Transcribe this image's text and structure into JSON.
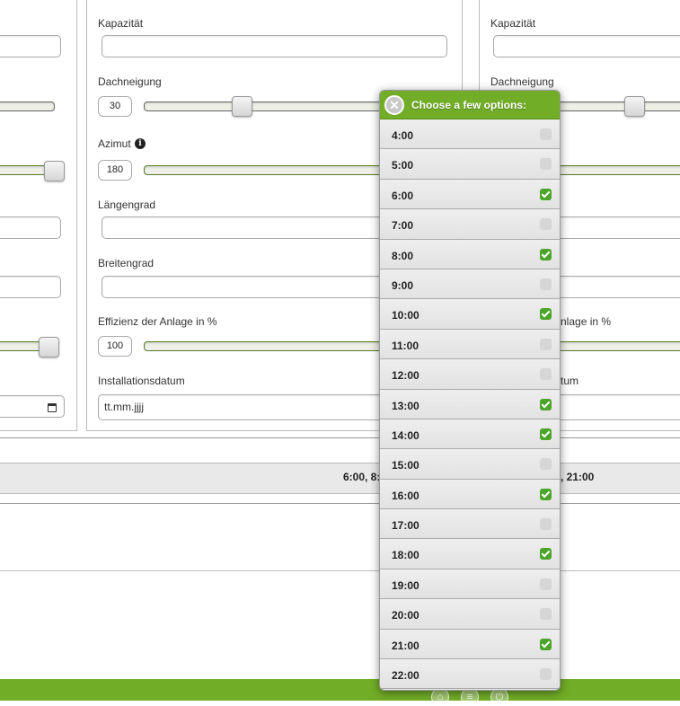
{
  "left_panel": {
    "date_icon": "calendar-icon"
  },
  "middle_panel": {
    "kapazitaet_label": "Kapazität",
    "kapazitaet_value": "",
    "dachneigung_label": "Dachneigung",
    "dachneigung_value": "30",
    "dachneigung_level": 0.27,
    "azimut_label": "Azimut",
    "azimut_info_icon": "info-icon",
    "azimut_value": "180",
    "laengengrad_label": "Längengrad",
    "laengengrad_value": "",
    "breitengrad_label": "Breitengrad",
    "breitengrad_value": "",
    "effizienz_label": "Effizienz der Anlage in %",
    "effizienz_value": "100",
    "installationsdatum_label": "Installationsdatum",
    "installationsdatum_value": "tt.mm.jjjj"
  },
  "right_panel": {
    "kapazitaet_label": "Kapazität",
    "dachneigung_label": "Dachneigung",
    "effizienz_label_partial": "nlage in %",
    "installationsdatum_label_partial": "tum"
  },
  "summary": {
    "selected_text_left": "6:00, 8:",
    "selected_text_right": ", 21:00"
  },
  "popup": {
    "title": "Choose a few options:",
    "close_icon": "close-icon",
    "options": [
      {
        "label": "4:00",
        "checked": false
      },
      {
        "label": "5:00",
        "checked": false
      },
      {
        "label": "6:00",
        "checked": true
      },
      {
        "label": "7:00",
        "checked": false
      },
      {
        "label": "8:00",
        "checked": true
      },
      {
        "label": "9:00",
        "checked": false
      },
      {
        "label": "10:00",
        "checked": true
      },
      {
        "label": "11:00",
        "checked": false
      },
      {
        "label": "12:00",
        "checked": false
      },
      {
        "label": "13:00",
        "checked": true
      },
      {
        "label": "14:00",
        "checked": true
      },
      {
        "label": "15:00",
        "checked": false
      },
      {
        "label": "16:00",
        "checked": true
      },
      {
        "label": "17:00",
        "checked": false
      },
      {
        "label": "18:00",
        "checked": true
      },
      {
        "label": "19:00",
        "checked": false
      },
      {
        "label": "20:00",
        "checked": false
      },
      {
        "label": "21:00",
        "checked": true
      },
      {
        "label": "22:00",
        "checked": false
      }
    ]
  },
  "footer": {
    "icons": [
      "home-icon",
      "menu-icon",
      "power-icon"
    ],
    "color": "#71ad26"
  }
}
